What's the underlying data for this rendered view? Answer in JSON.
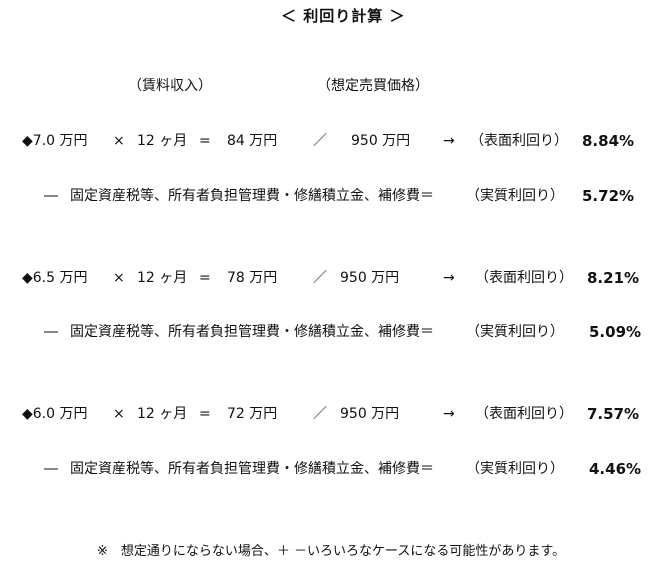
{
  "title": "＜ 利回り計算 ＞",
  "headers": {
    "rent_income": "（賃料収入）",
    "assumed_price": "（想定売買価格）"
  },
  "rows": [
    {
      "rent": "◆7.0 万円",
      "times": "×",
      "months": "12 ヶ月",
      "equals": "=",
      "annual": "84 万円",
      "slash": "／",
      "price": "950 万円",
      "arrow": "→",
      "gross_label": "（表面利回り）",
      "gross_value": "8.84%",
      "net_prefix": "―",
      "net_text": "固定資産税等、所有者負担管理費・修繕積立金、補修費＝",
      "net_label": "（実質利回り）",
      "net_value": "5.72%"
    },
    {
      "rent": "◆6.5 万円",
      "times": "×",
      "months": "12 ヶ月",
      "equals": "=",
      "annual": "78 万円",
      "slash": "／",
      "price": "950 万円",
      "arrow": "→",
      "gross_label": "（表面利回り）",
      "gross_value": "8.21%",
      "net_prefix": "―",
      "net_text": "固定資産税等、所有者負担管理費・修繕積立金、補修費＝",
      "net_label": "（実質利回り）",
      "net_value": "5.09%"
    },
    {
      "rent": "◆6.0 万円",
      "times": "×",
      "months": "12 ヶ月",
      "equals": "=",
      "annual": "72 万円",
      "slash": "／",
      "price": "950 万円",
      "arrow": "→",
      "gross_label": "（表面利回り）",
      "gross_value": "7.57%",
      "net_prefix": "―",
      "net_text": "固定資産税等、所有者負担管理費・修繕積立金、補修費＝",
      "net_label": "（実質利回り）",
      "net_value": "4.46%"
    }
  ],
  "footnote": "※　想定通りにならない場合、＋ －いろいろなケースになる可能性があります。"
}
